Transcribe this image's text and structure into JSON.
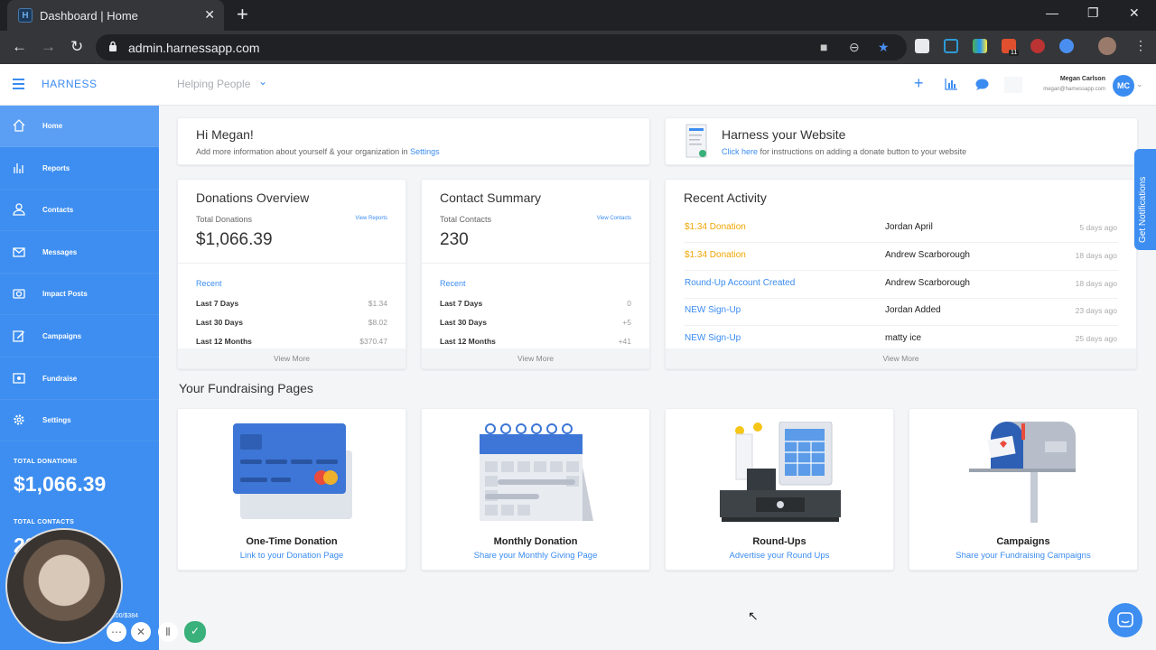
{
  "browser": {
    "tab_title": "Dashboard | Home",
    "tab_favicon": "H",
    "url": "admin.harnessapp.com",
    "extension_badge": "11"
  },
  "header": {
    "brand": "HARNESS",
    "org": "Helping People",
    "user_name": "Megan Carlson",
    "user_email": "megan@harnessapp.com",
    "avatar_initials": "MC"
  },
  "sidebar": {
    "items": [
      {
        "label": "Home",
        "icon": "home-icon"
      },
      {
        "label": "Reports",
        "icon": "bar-chart-icon"
      },
      {
        "label": "Contacts",
        "icon": "person-icon"
      },
      {
        "label": "Messages",
        "icon": "mail-icon"
      },
      {
        "label": "Impact Posts",
        "icon": "camera-icon"
      },
      {
        "label": "Campaigns",
        "icon": "edit-icon"
      },
      {
        "label": "Fundraise",
        "icon": "frame-icon"
      },
      {
        "label": "Settings",
        "icon": "gear-icon"
      }
    ],
    "total_donations_label": "TOTAL DONATIONS",
    "total_donations_value": "$1,066.39",
    "total_contacts_label": "TOTAL CONTACTS",
    "total_contacts_value": "230",
    "progress_text": "$0.00/$384"
  },
  "welcome": {
    "title": "Hi Megan!",
    "text": "Add more information about yourself & your organization in ",
    "link": "Settings"
  },
  "website": {
    "title": "Harness your Website",
    "link": "Click here",
    "text": " for instructions on adding a donate button to your website"
  },
  "donations": {
    "title": "Donations Overview",
    "sub": "Total Donations",
    "view_link": "View Reports",
    "value": "$1,066.39",
    "recent": "Recent",
    "rows": [
      {
        "label": "Last 7 Days",
        "value": "$1.34"
      },
      {
        "label": "Last 30 Days",
        "value": "$8.02"
      },
      {
        "label": "Last 12 Months",
        "value": "$370.47"
      }
    ],
    "view_more": "View More"
  },
  "contacts": {
    "title": "Contact Summary",
    "sub": "Total Contacts",
    "view_link": "View Contacts",
    "value": "230",
    "recent": "Recent",
    "rows": [
      {
        "label": "Last 7 Days",
        "value": "0"
      },
      {
        "label": "Last 30 Days",
        "value": "+5"
      },
      {
        "label": "Last 12 Months",
        "value": "+41"
      }
    ],
    "view_more": "View More"
  },
  "activity": {
    "title": "Recent Activity",
    "rows": [
      {
        "type": "$1.34 Donation",
        "name": "Jordan April",
        "time": "5 days ago",
        "color": "#f0a500"
      },
      {
        "type": "$1.34 Donation",
        "name": "Andrew Scarborough",
        "time": "18 days ago",
        "color": "#f0a500"
      },
      {
        "type": "Round-Up Account Created",
        "name": "Andrew Scarborough",
        "time": "18 days ago",
        "color": "#3b8cf0"
      },
      {
        "type": "NEW Sign-Up",
        "name": "Jordan Added",
        "time": "23 days ago",
        "color": "#3b8cf0"
      },
      {
        "type": "NEW Sign-Up",
        "name": "matty ice",
        "time": "25 days ago",
        "color": "#3b8cf0"
      }
    ],
    "view_more": "View More"
  },
  "fundraising": {
    "title": "Your Fundraising Pages",
    "pages": [
      {
        "title": "One-Time Donation",
        "sub": "Link to your Donation Page"
      },
      {
        "title": "Monthly Donation",
        "sub": "Share your Monthly Giving Page"
      },
      {
        "title": "Round-Ups",
        "sub": "Advertise your Round Ups"
      },
      {
        "title": "Campaigns",
        "sub": "Share your Fundraising Campaigns"
      }
    ]
  },
  "notifications_tab": "Get Notifications",
  "colors": {
    "accent": "#3d8ef0",
    "donation": "#f0a500"
  }
}
